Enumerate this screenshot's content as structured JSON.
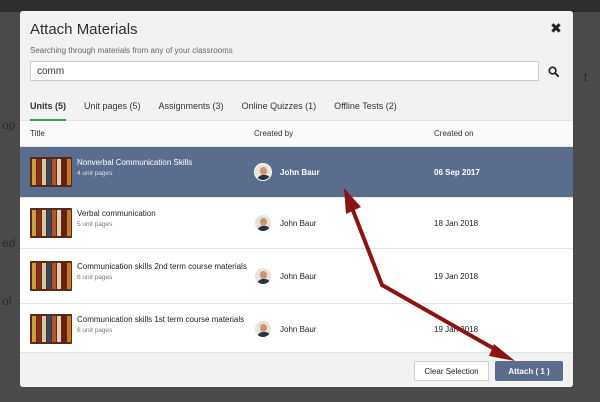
{
  "background": {
    "fragments": [
      "t",
      "op",
      "ed",
      "ol"
    ]
  },
  "modal": {
    "title": "Attach Materials",
    "subtitle": "Searching through materials from any of your classrooms",
    "search": {
      "value": "comm",
      "placeholder": ""
    },
    "tabs": [
      {
        "label": "Units (5)",
        "active": true
      },
      {
        "label": "Unit pages (5)",
        "active": false
      },
      {
        "label": "Assignments (3)",
        "active": false
      },
      {
        "label": "Online Quizzes (1)",
        "active": false
      },
      {
        "label": "Offline Tests (2)",
        "active": false
      }
    ],
    "columns": {
      "title": "Title",
      "created_by": "Created by",
      "created_on": "Created on"
    },
    "rows": [
      {
        "title": "Nonverbal Communication Skills",
        "sub": "4 unit pages",
        "creator": "John Baur",
        "date": "06 Sep 2017",
        "selected": true
      },
      {
        "title": "Verbal communication",
        "sub": "5 unit pages",
        "creator": "John Baur",
        "date": "18 Jan 2018",
        "selected": false
      },
      {
        "title": "Communication skills 2nd term course materials",
        "sub": "6 unit pages",
        "creator": "John Baur",
        "date": "19 Jan 2018",
        "selected": false
      },
      {
        "title": "Communication skills 1st term course materials",
        "sub": "6 unit pages",
        "creator": "John Baur",
        "date": "19 Jan 2018",
        "selected": false
      }
    ],
    "footer": {
      "clear_label": "Clear Selection",
      "attach_label": "Attach ( 1 )"
    }
  },
  "colors": {
    "accent": "#5b6d8d",
    "tab_underline": "#3a9d5d",
    "arrow": "#8a1414"
  },
  "icons": {
    "close": "close-icon",
    "search": "search-icon"
  }
}
